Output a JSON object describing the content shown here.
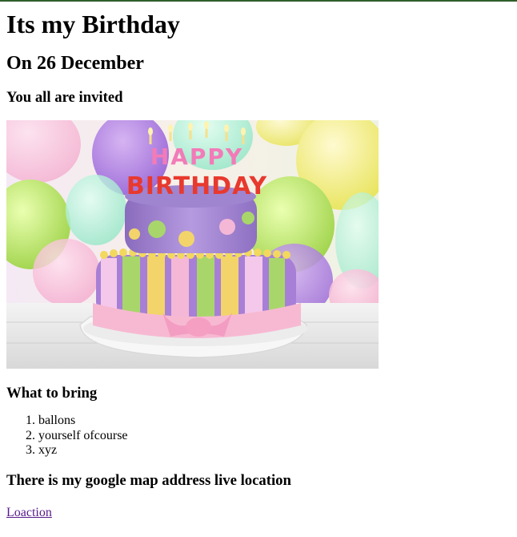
{
  "heading": {
    "title": "Its my Birthday",
    "date": "On 26 December",
    "invite": "You all are invited"
  },
  "cake_image": {
    "topper_letters_line1": "HAPPY",
    "topper_letters_line2": "BIRTHDAY"
  },
  "bring": {
    "title": "What to bring",
    "items": [
      "ballons",
      "yourself ofcourse",
      "xyz"
    ]
  },
  "map": {
    "title": "There is my google map address live location",
    "link_label": "Loaction"
  },
  "colors": {
    "link": "#551a8b",
    "top_border": "#2e5e2a"
  }
}
